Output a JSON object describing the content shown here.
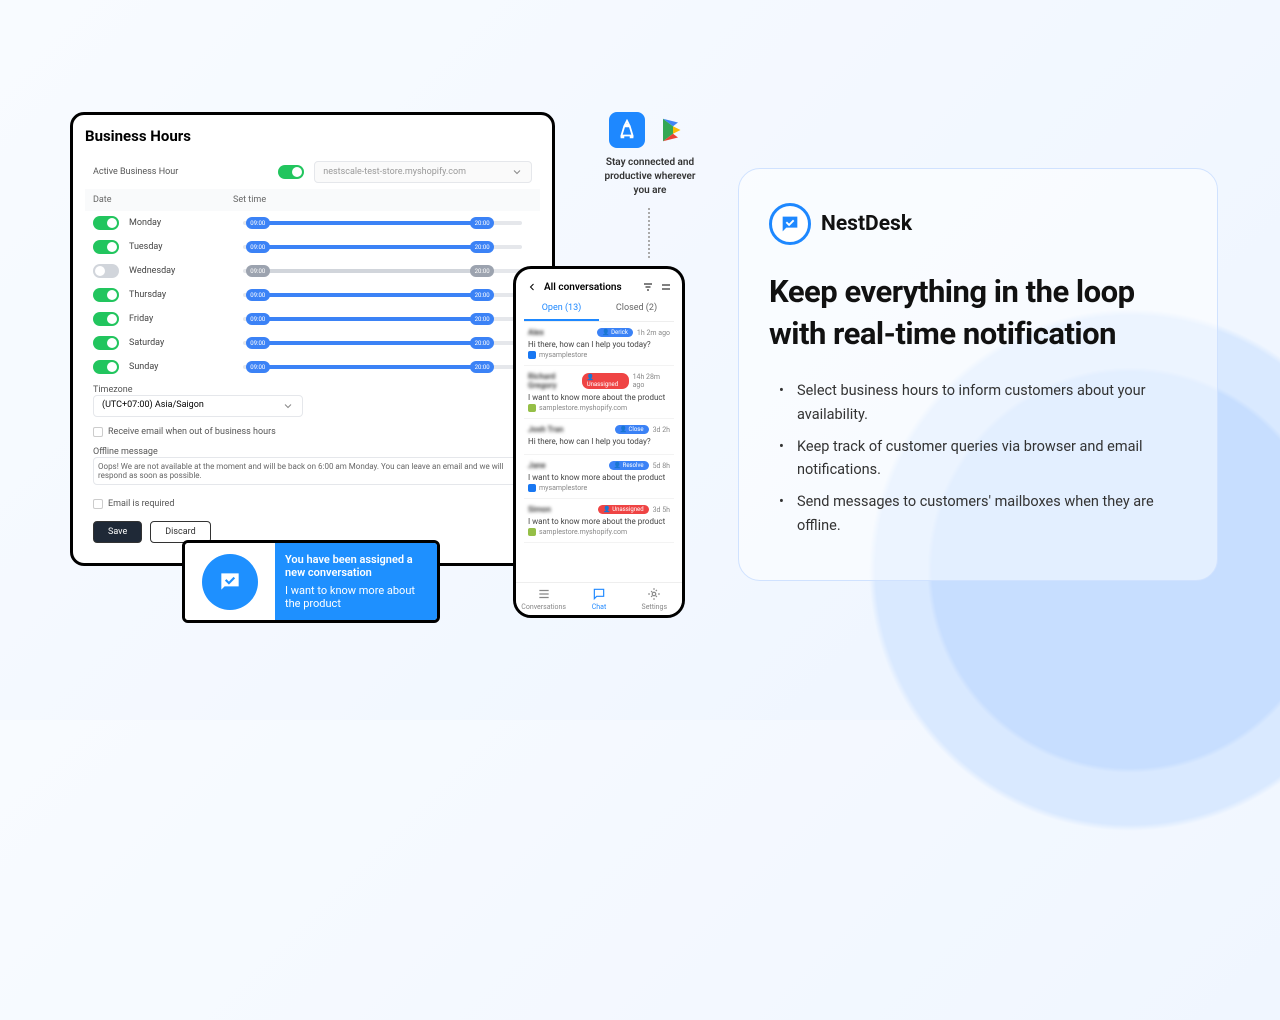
{
  "businessHours": {
    "title": "Business Hours",
    "activeLabel": "Active Business Hour",
    "store": "nestscale-test-store.myshopify.com",
    "dateHdr": "Date",
    "timeHdr": "Set time",
    "days": [
      {
        "name": "Monday",
        "on": true,
        "start": "09:00",
        "end": "20:00"
      },
      {
        "name": "Tuesday",
        "on": true,
        "start": "09:00",
        "end": "20:00"
      },
      {
        "name": "Wednesday",
        "on": false,
        "start": "09:00",
        "end": "20:00"
      },
      {
        "name": "Thursday",
        "on": true,
        "start": "09:00",
        "end": "20:00"
      },
      {
        "name": "Friday",
        "on": true,
        "start": "09:00",
        "end": "20:00"
      },
      {
        "name": "Saturday",
        "on": true,
        "start": "09:00",
        "end": "20:00"
      },
      {
        "name": "Sunday",
        "on": true,
        "start": "09:00",
        "end": "20:00"
      }
    ],
    "tzLabel": "Timezone",
    "tz": "(UTC+07:00) Asia/Saigon",
    "receiveEmail": "Receive email when out of business hours",
    "offlineLabel": "Offline message",
    "offlineMsg": "Oops! We are not available at the moment and will be back on 6:00 am Monday. You can leave an email and we will respond as soon as possible.",
    "emailReq": "Email is required",
    "save": "Save",
    "discard": "Discard"
  },
  "toast": {
    "title": "You have been assigned a new conversation",
    "body": "I want to know more about the product"
  },
  "stores": {
    "text": "Stay connected and productive wherever you are"
  },
  "phone": {
    "title": "All conversations",
    "tabs": {
      "open": "Open (13)",
      "closed": "Closed (2)"
    },
    "convs": [
      {
        "name": "Alex",
        "badge": "Derick",
        "badgeCls": "der",
        "time": "1h 2m ago",
        "msg": "Hi there, how can I help you today?",
        "src": "mysamplestore",
        "srcCls": "ic"
      },
      {
        "name": "Richard Gregory",
        "badge": "Unassigned",
        "badgeCls": "un",
        "time": "14h 28m ago",
        "msg": "I want to know more about the product",
        "src": "samplestore.myshopify.com",
        "srcCls": "ic sh"
      },
      {
        "name": "Josh Tran",
        "badge": "Close",
        "badgeCls": "cl",
        "time": "3d 2h",
        "msg": "Hi there, how can I help you today?",
        "src": "",
        "srcCls": ""
      },
      {
        "name": "Jane",
        "badge": "Resolve",
        "badgeCls": "der",
        "time": "5d 8h",
        "msg": "I want to know more about the product",
        "src": "mysamplestore",
        "srcCls": "ic"
      },
      {
        "name": "Simon",
        "badge": "Unassigned",
        "badgeCls": "un",
        "time": "3d 5h",
        "msg": "I want to know more about the product",
        "src": "samplestore.myshopify.com",
        "srcCls": "ic sh"
      }
    ],
    "nav": {
      "conv": "Conversations",
      "chat": "Chat",
      "set": "Settings"
    }
  },
  "card": {
    "brand": "NestDesk",
    "heading": "Keep everything in the loop with real-time notification",
    "bullets": [
      "Select business hours to inform customers about your availability.",
      "Keep track of customer queries via browser and email notifications.",
      "Send messages to customers' mailboxes when they are offline."
    ]
  }
}
